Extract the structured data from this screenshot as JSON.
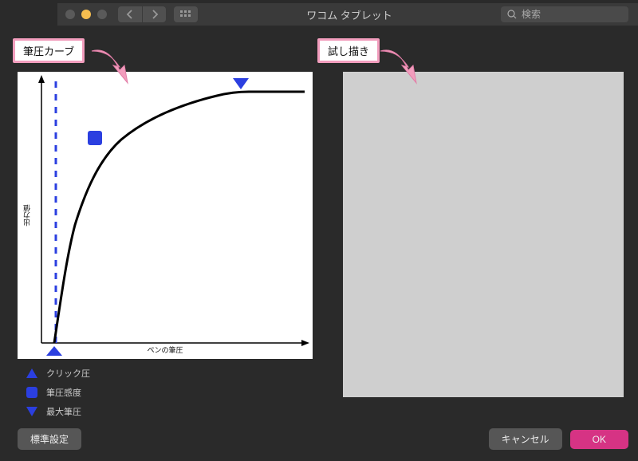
{
  "window": {
    "title": "ワコム タブレット"
  },
  "search": {
    "placeholder": "検索"
  },
  "callouts": {
    "curve": "筆圧カーブ",
    "test": "試し描き"
  },
  "chart_data": {
    "type": "line",
    "title": "",
    "xlabel": "ペンの筆圧",
    "ylabel": "出力値",
    "xlim": [
      0,
      100
    ],
    "ylim": [
      0,
      100
    ],
    "curve_points": [
      {
        "x": 5,
        "y": 0
      },
      {
        "x": 8,
        "y": 20
      },
      {
        "x": 12,
        "y": 45
      },
      {
        "x": 18,
        "y": 62
      },
      {
        "x": 28,
        "y": 77
      },
      {
        "x": 40,
        "y": 86
      },
      {
        "x": 55,
        "y": 91
      },
      {
        "x": 70,
        "y": 94
      },
      {
        "x": 78,
        "y": 95
      },
      {
        "x": 100,
        "y": 95
      }
    ],
    "handles": {
      "click_threshold": {
        "x": 5,
        "y": 0,
        "symbol": "triangle-up"
      },
      "sensitivity": {
        "x": 20,
        "y": 78,
        "symbol": "square"
      },
      "max_pressure": {
        "x": 78,
        "y": 97,
        "symbol": "triangle-down"
      }
    },
    "threshold_line_x": 7
  },
  "legend": {
    "click": "クリック圧",
    "sensitivity": "筆圧感度",
    "max": "最大筆圧"
  },
  "buttons": {
    "defaults": "標準設定",
    "cancel": "キャンセル",
    "ok": "OK"
  },
  "colors": {
    "handle_blue": "#2b3fe0",
    "pink": "#d63384",
    "callout_border": "#f29dbd"
  }
}
